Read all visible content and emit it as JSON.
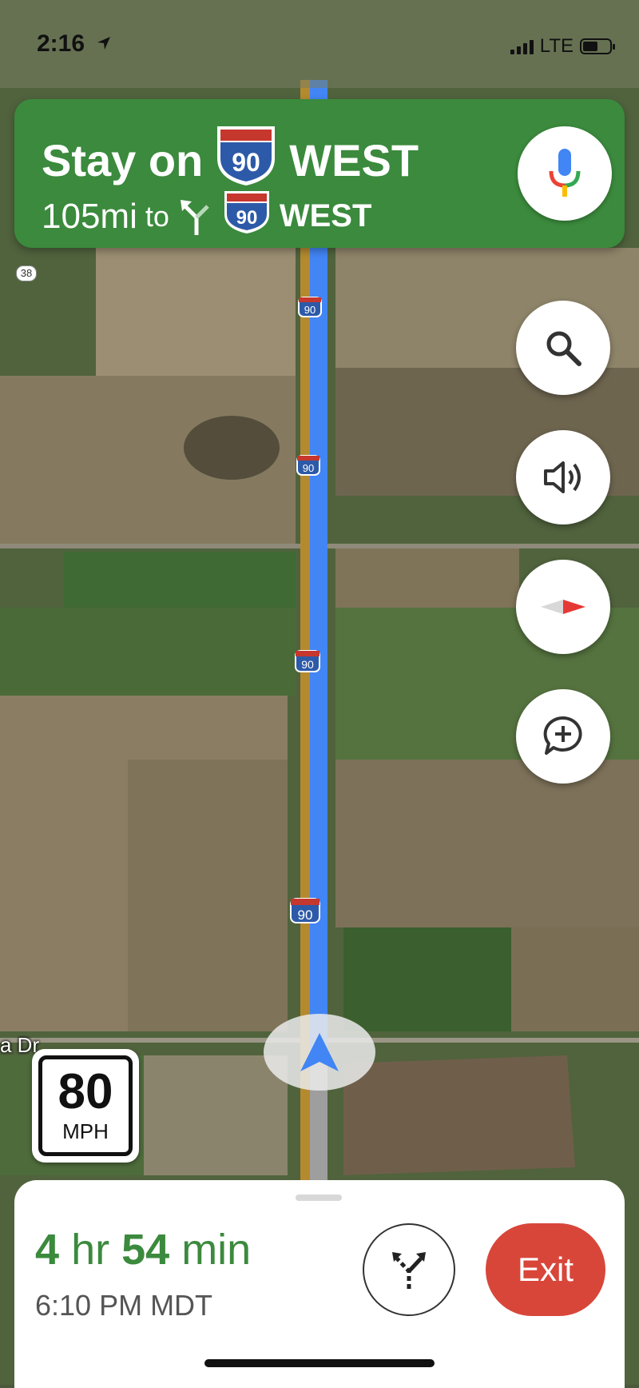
{
  "status_bar": {
    "time": "2:16",
    "network": "LTE"
  },
  "banner": {
    "instruction_prefix": "Stay on",
    "highway_number": "90",
    "direction": "WEST",
    "distance": "105mi",
    "to_word": "to",
    "next_highway_number": "90",
    "next_direction": "WEST",
    "background_color": "#3b8a3d"
  },
  "map": {
    "highway_markers": [
      "90",
      "90",
      "90",
      "90"
    ],
    "route_marker": "38",
    "road_label": "a Dr",
    "route_color": "#4285f4"
  },
  "speed_limit": {
    "value": "80",
    "unit": "MPH"
  },
  "buttons": {
    "mic": "mic-icon",
    "search": "search-icon",
    "sound": "volume-icon",
    "compass": "compass-icon",
    "report": "add-report-icon"
  },
  "bottom_sheet": {
    "duration_hr_num": "4",
    "duration_hr_unit": "hr",
    "duration_min_num": "54",
    "duration_min_unit": "min",
    "arrival": "6:10 PM MDT",
    "exit_label": "Exit",
    "exit_color": "#d8463a"
  }
}
